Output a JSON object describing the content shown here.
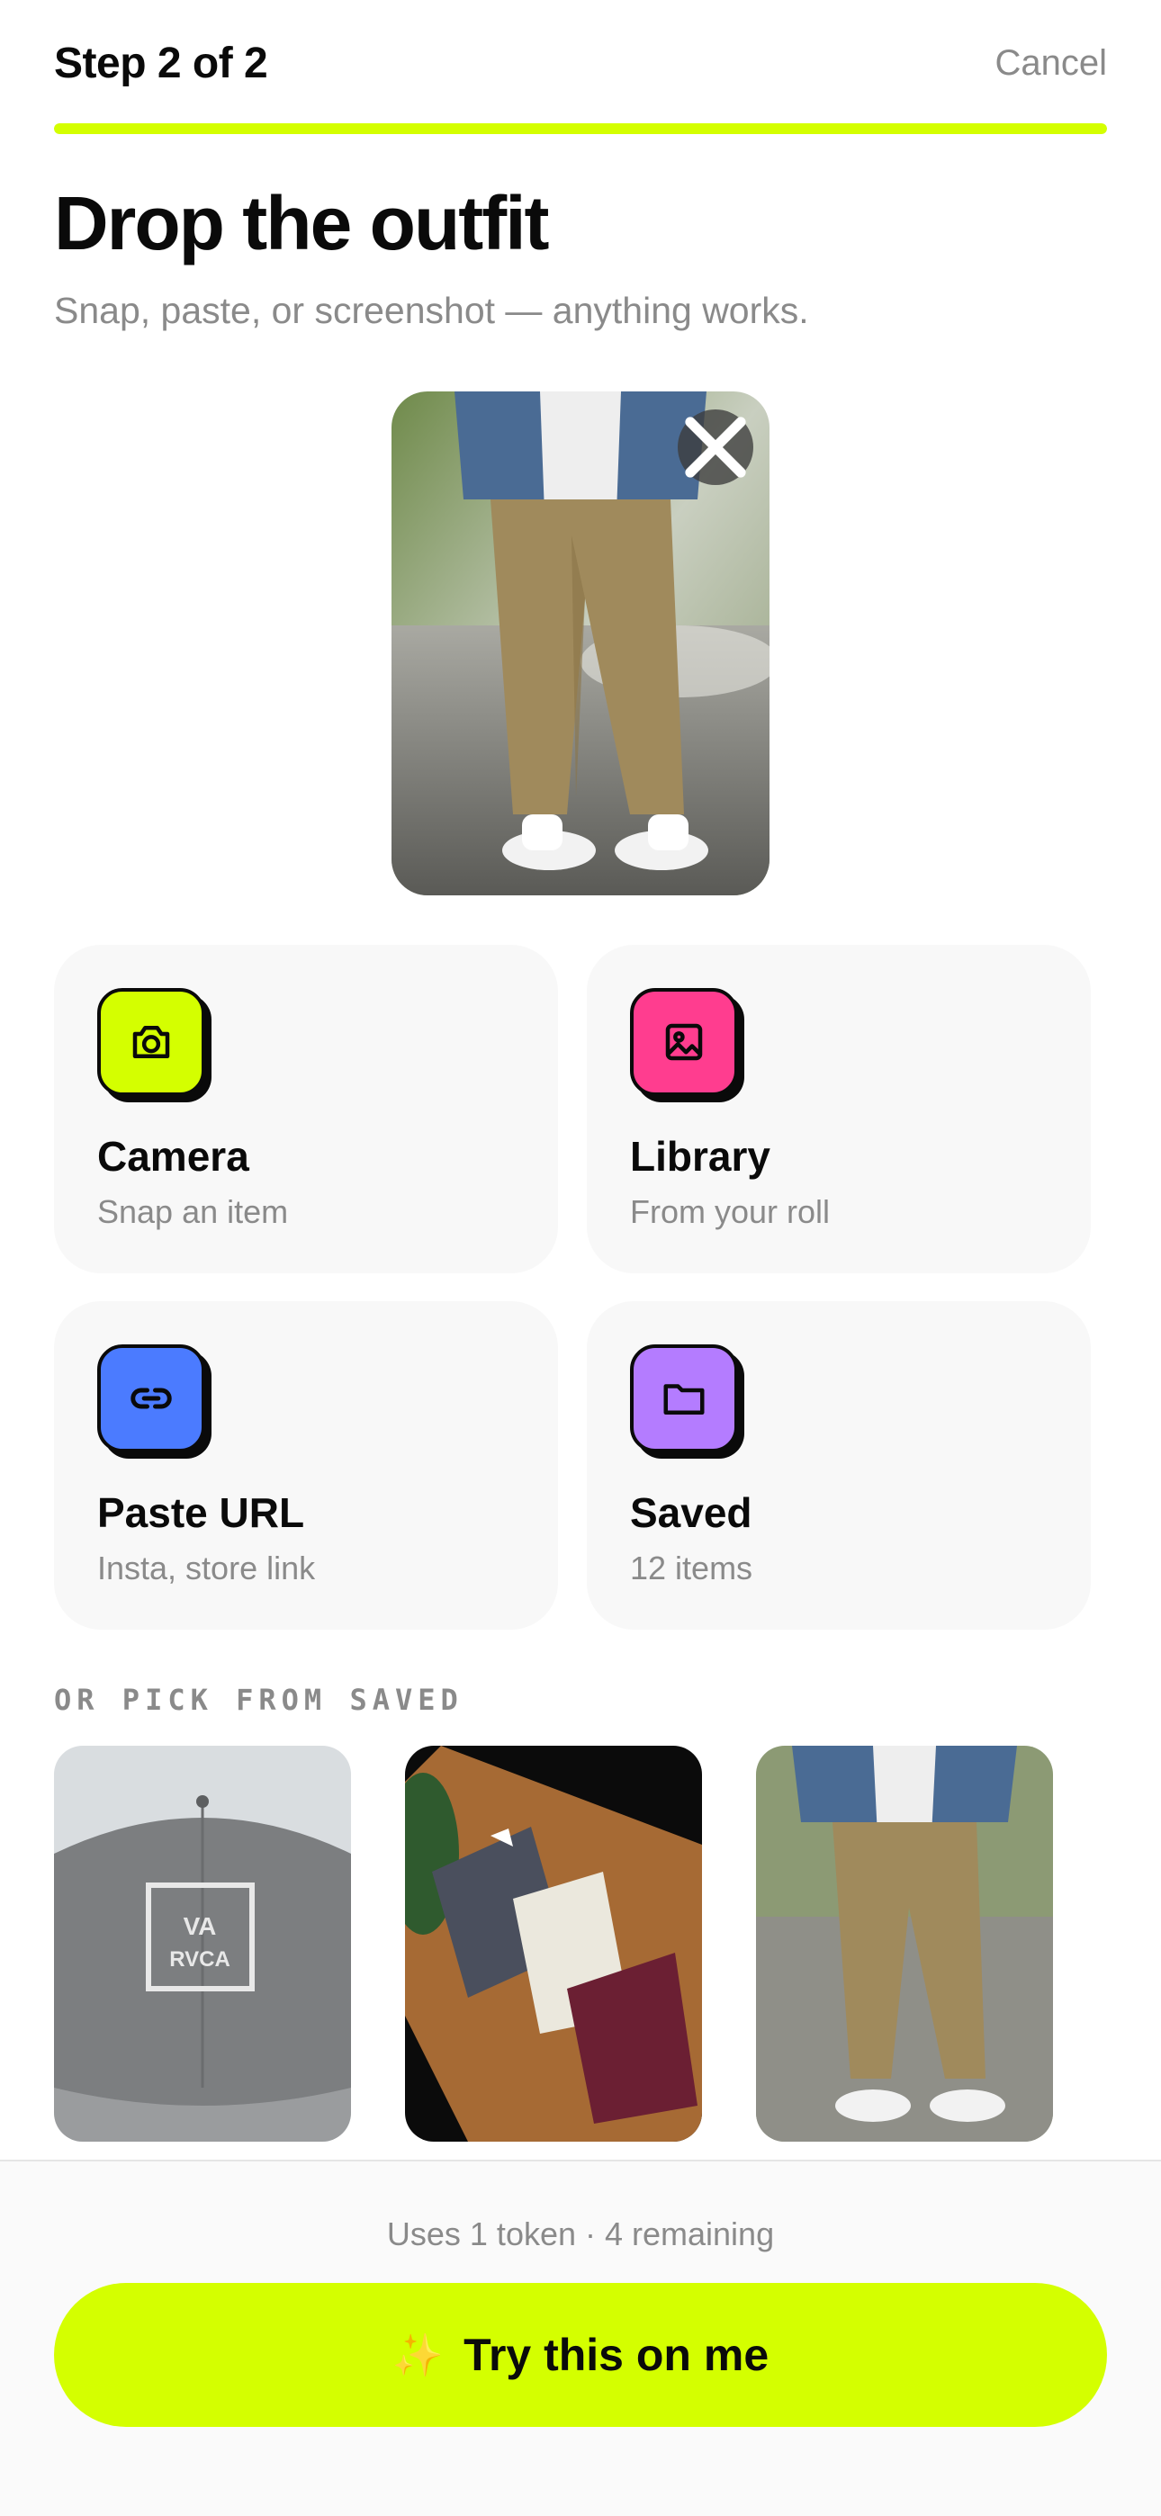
{
  "header": {
    "step": "Step 2 of 2",
    "cancel": "Cancel",
    "progress": 1.0
  },
  "title": "Drop the outfit",
  "subtitle": "Snap, paste, or screenshot — anything works.",
  "sources": [
    {
      "title": "Camera",
      "subtitle": "Snap an item",
      "icon": "camera-icon",
      "color": "#d4ff00"
    },
    {
      "title": "Library",
      "subtitle": "From your roll",
      "icon": "image-icon",
      "color": "#ff3d8f"
    },
    {
      "title": "Paste URL",
      "subtitle": "Insta, store link",
      "icon": "link-icon",
      "color": "#4b7bff"
    },
    {
      "title": "Saved",
      "subtitle": "12 items",
      "icon": "folder-icon",
      "color": "#b47cff"
    }
  ],
  "saved_section": {
    "label": "OR PICK FROM SAVED"
  },
  "footer": {
    "tokens": "Uses 1 token · 4 remaining",
    "cta": "Try this on me",
    "cta_icon": "✨"
  },
  "colors": {
    "accent": "#d4ff00",
    "muted": "#8a8a8a"
  }
}
